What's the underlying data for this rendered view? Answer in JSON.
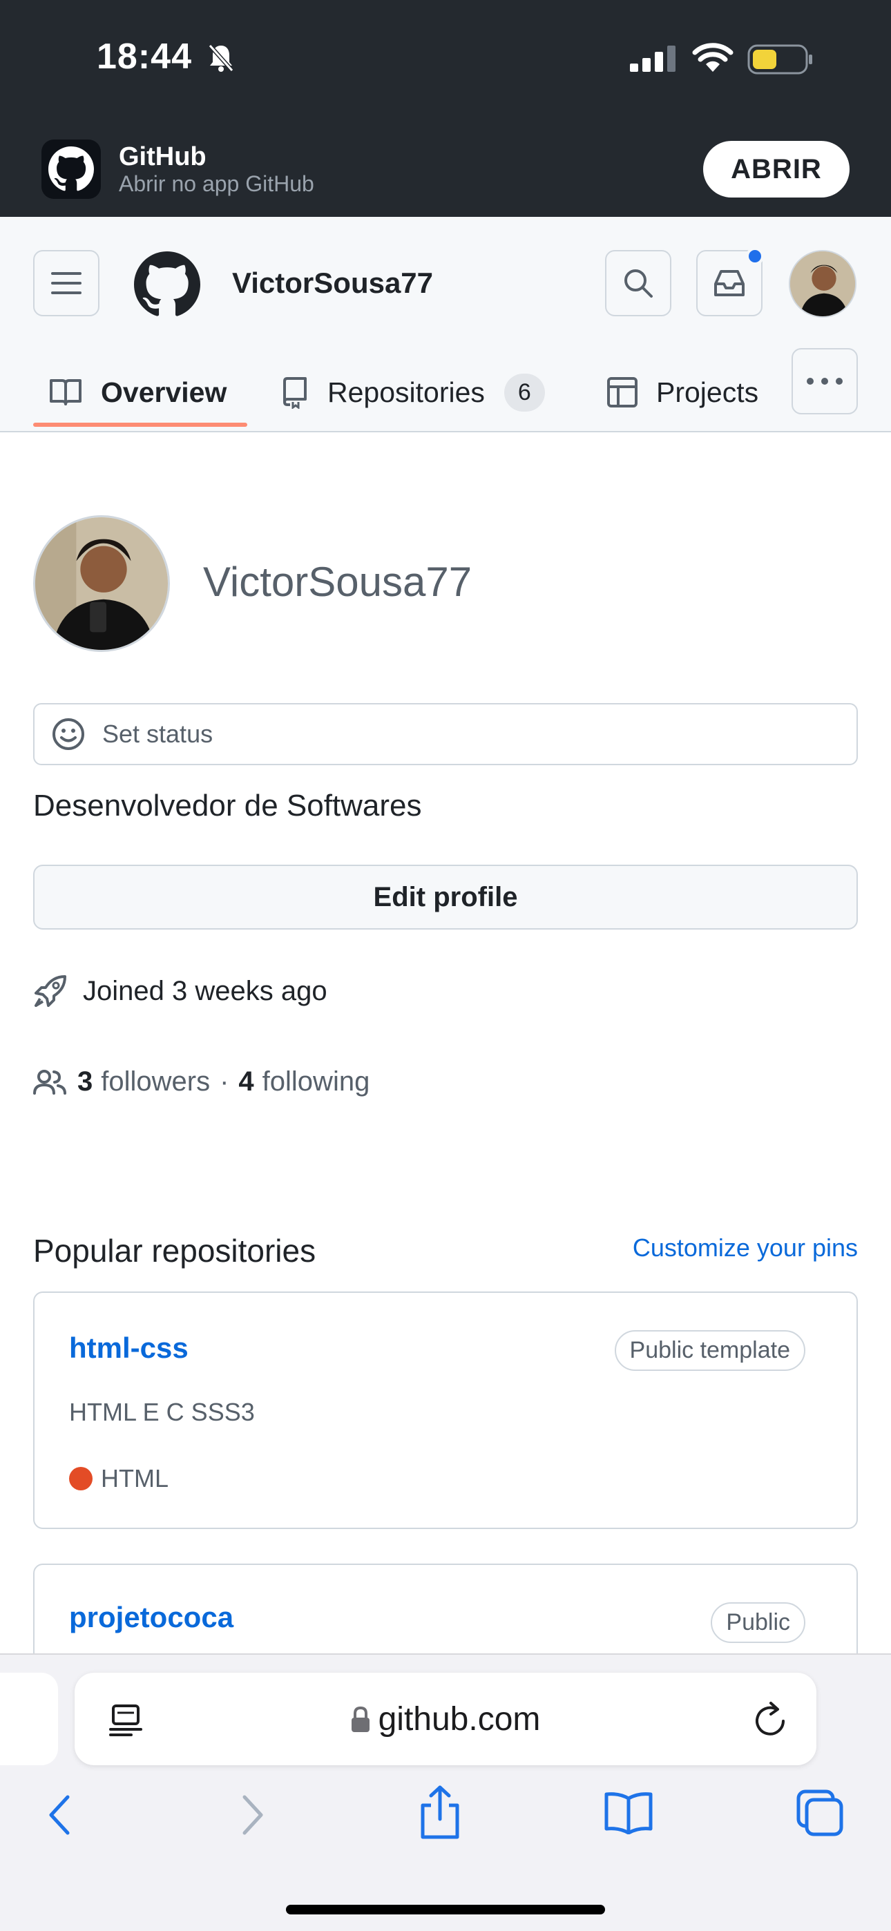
{
  "status_bar": {
    "time": "18:44"
  },
  "app_banner": {
    "title": "GitHub",
    "subtitle": "Abrir no app GitHub",
    "open_label": "ABRIR"
  },
  "header": {
    "username": "VictorSousa77",
    "tabs": [
      {
        "label": "Overview",
        "active": true
      },
      {
        "label": "Repositories",
        "count": "6"
      },
      {
        "label": "Projects"
      }
    ]
  },
  "profile": {
    "name": "VictorSousa77",
    "status_placeholder": "Set status",
    "bio": "Desenvolvedor de Softwares",
    "edit_label": "Edit profile",
    "joined": "Joined 3 weeks ago",
    "followers_count": "3",
    "followers_label": "followers",
    "separator": "·",
    "following_count": "4",
    "following_label": "following"
  },
  "popular": {
    "title": "Popular repositories",
    "customize_label": "Customize your pins",
    "repos": [
      {
        "name": "html-css",
        "visibility": "Public template",
        "description": "HTML E C SSS3",
        "language": "HTML",
        "language_color": "#e34c26"
      },
      {
        "name": "projetococa",
        "visibility": "Public"
      }
    ]
  },
  "browser": {
    "url": "github.com"
  },
  "colors": {
    "accent": "#0969da",
    "tab_underline": "#fd8c73",
    "dark_bar": "#24292f"
  }
}
